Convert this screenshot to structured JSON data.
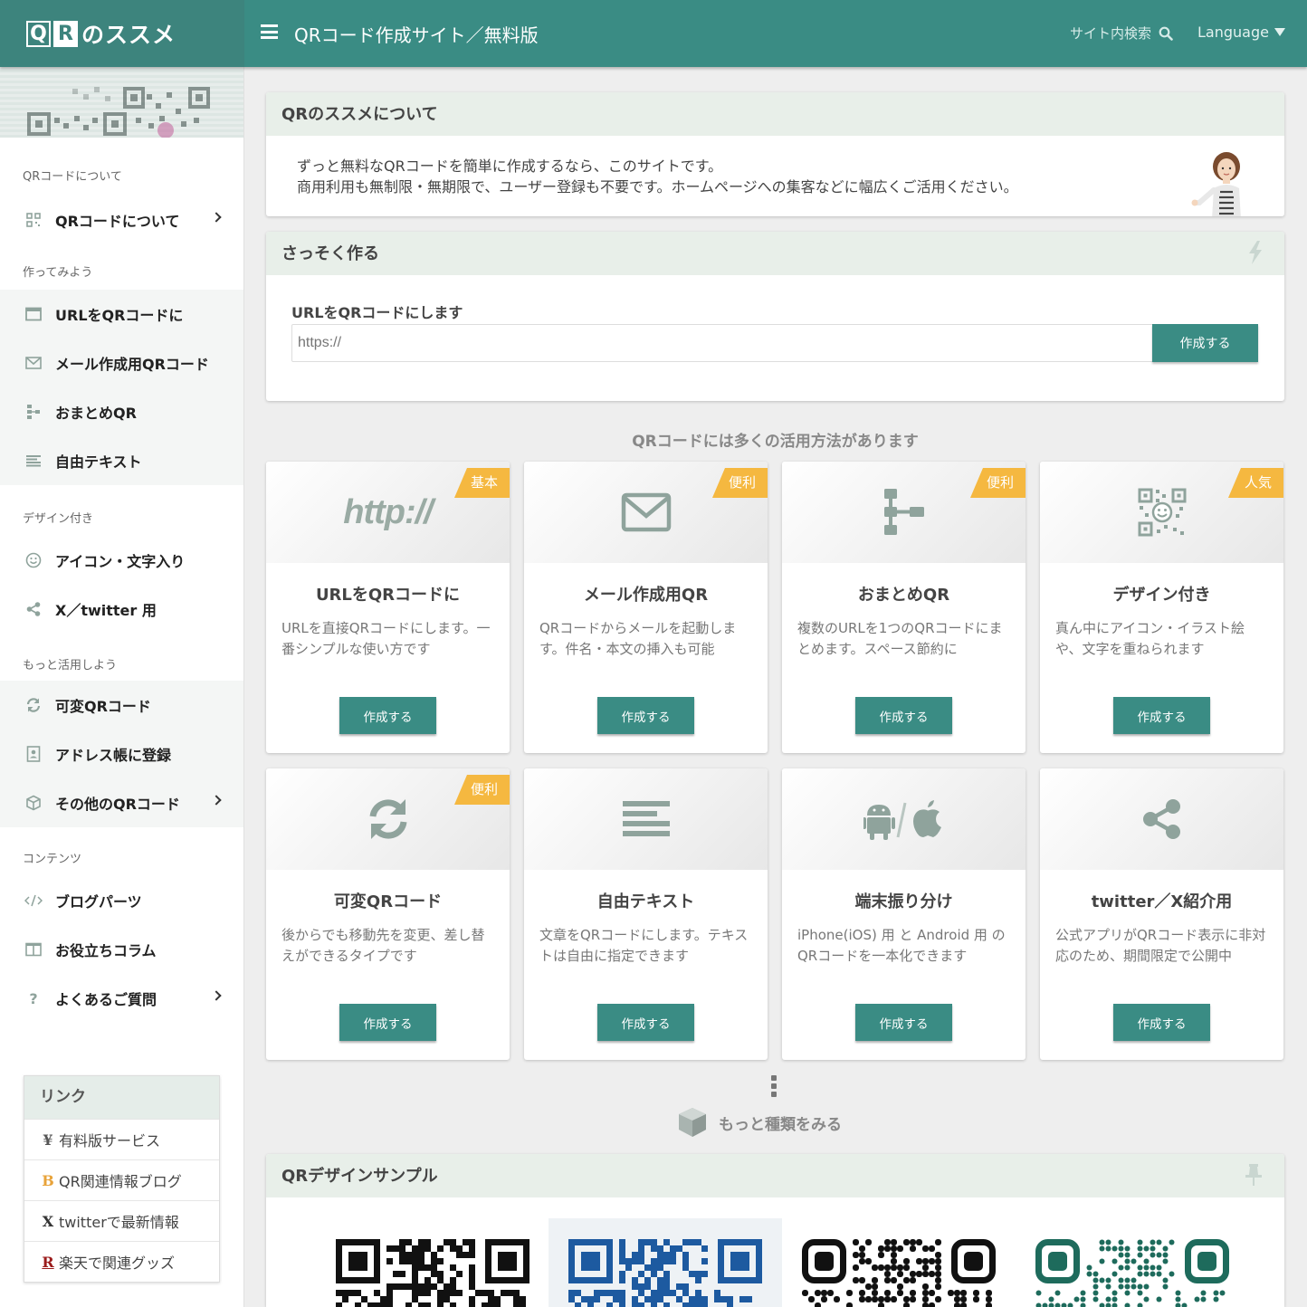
{
  "header": {
    "logo_q": "Q",
    "logo_r": "R",
    "logo_text": "のススメ",
    "title": "QRコード作成サイト／無料版",
    "search_label": "サイト内検索",
    "language_label": "Language"
  },
  "sidebar": {
    "sections": [
      {
        "label": "QRコードについて"
      },
      {
        "label": "作ってみよう"
      },
      {
        "label": "デザイン付き"
      },
      {
        "label": "もっと活用しよう"
      },
      {
        "label": "コンテンツ"
      }
    ],
    "items": [
      {
        "label": "QRコードについて",
        "icon": "qr-icon"
      },
      {
        "label": "URLをQRコードに",
        "icon": "browser-window-icon"
      },
      {
        "label": "メール作成用QRコード",
        "icon": "envelope-icon"
      },
      {
        "label": "おまとめQR",
        "icon": "sitemap-icon"
      },
      {
        "label": "自由テキスト",
        "icon": "text-lines-icon"
      },
      {
        "label": "アイコン・文字入り",
        "icon": "smile-icon"
      },
      {
        "label": "X／twitter 用",
        "icon": "share-icon"
      },
      {
        "label": "可変QRコード",
        "icon": "refresh-icon"
      },
      {
        "label": "アドレス帳に登録",
        "icon": "address-book-icon"
      },
      {
        "label": "その他のQRコード",
        "icon": "cube-icon"
      },
      {
        "label": "ブログパーツ",
        "icon": "code-icon"
      },
      {
        "label": "お役立ちコラム",
        "icon": "book-icon"
      },
      {
        "label": "よくあるご質問",
        "icon": "question-icon"
      }
    ],
    "links": {
      "title": "リンク",
      "items": [
        {
          "mark": "¥",
          "label": "有料版サービス",
          "color": "#555555"
        },
        {
          "mark": "B",
          "label": "QR関連情報ブログ",
          "color": "#e8a33a"
        },
        {
          "mark": "X",
          "label": "twitterで最新情報",
          "color": "#333333"
        },
        {
          "mark": "R",
          "label": "楽天で関連グッズ",
          "color": "#9b1c1c"
        }
      ]
    }
  },
  "about": {
    "title": "QRのススメについて",
    "line1": "ずっと無料なQRコードを簡単に作成するなら、このサイトです。",
    "line2": "商用利用も無制限・無期限で、ユーザー登録も不要です。ホームページへの集客などに幅広くご活用ください。"
  },
  "quick": {
    "title": "さっそく作る",
    "label": "URLをQRコードにします",
    "placeholder": "https://",
    "button": "作成する"
  },
  "uses": {
    "title": "QRコードには多くの活用方法があります",
    "cards": [
      {
        "title": "URLをQRコードに",
        "desc": "URLを直接QRコードにします。一番シンプルな使い方です",
        "badge": "基本",
        "icon": "http-icon",
        "icon_text": "http://",
        "button": "作成する"
      },
      {
        "title": "メール作成用QR",
        "desc": "QRコードからメールを起動します。件名・本文の挿入も可能",
        "badge": "便利",
        "icon": "envelope-icon",
        "button": "作成する"
      },
      {
        "title": "おまとめQR",
        "desc": "複数のURLを1つのQRコードにまとめます。スペース節約に",
        "badge": "便利",
        "icon": "sitemap-icon",
        "button": "作成する"
      },
      {
        "title": "デザイン付き",
        "desc": "真ん中にアイコン・イラスト絵や、文字を重ねられます",
        "badge": "人気",
        "icon": "qr-smile-icon",
        "button": "作成する"
      },
      {
        "title": "可変QRコード",
        "desc": "後からでも移動先を変更、差し替えができるタイプです",
        "badge": "便利",
        "icon": "refresh-icon",
        "button": "作成する"
      },
      {
        "title": "自由テキスト",
        "desc": "文章をQRコードにします。テキストは自由に指定できます",
        "badge": "",
        "icon": "text-lines-icon",
        "button": "作成する"
      },
      {
        "title": "端末振り分け",
        "desc": "iPhone(iOS) 用 と Android 用 の QRコードを一本化できます",
        "badge": "",
        "icon": "android-apple-icon",
        "button": "作成する"
      },
      {
        "title": "twitter／X紹介用",
        "desc": "公式アプリがQRコード表示に非対応のため、期間限定で公開中",
        "badge": "",
        "icon": "share-icon",
        "button": "作成する"
      }
    ],
    "more_label": "もっと種類をみる"
  },
  "samples": {
    "title": "QRデザインサンプル",
    "colors": [
      "#111111",
      "#1d5aa0",
      "#111111",
      "#1e6b5c"
    ]
  },
  "colors": {
    "brand": "#3a8c84",
    "badge": "#f5b840",
    "icon_gray": "#8fa39c"
  }
}
